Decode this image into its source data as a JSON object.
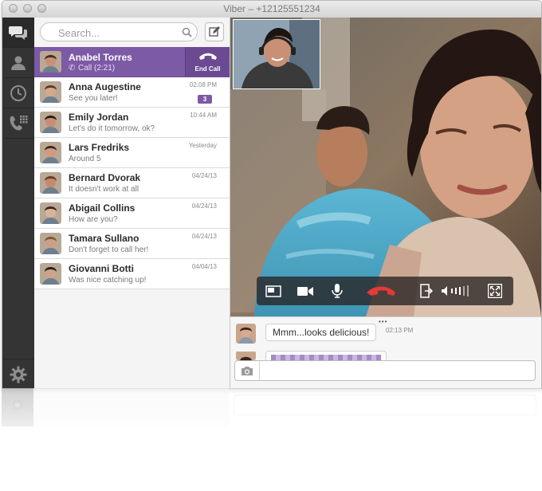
{
  "window": {
    "title": "Viber – +12125551234"
  },
  "search": {
    "placeholder": "Search..."
  },
  "contacts": [
    {
      "name": "Anabel Torres",
      "sub": "Call (2:21)",
      "time": "",
      "badge": "",
      "active": true,
      "skin": "#c99278",
      "hair": "#4a2a1c"
    },
    {
      "name": "Anna Augestine",
      "sub": "See you later!",
      "time": "02:08 PM",
      "badge": "3",
      "active": false,
      "skin": "#d6a88c",
      "hair": "#5a3a22"
    },
    {
      "name": "Emily Jordan",
      "sub": "Let's do it tomorrow, ok?",
      "time": "10:44 AM",
      "badge": "",
      "active": false,
      "skin": "#c98d73",
      "hair": "#2d1c14"
    },
    {
      "name": "Lars Fredriks",
      "sub": "Around 5",
      "time": "Yesterday",
      "badge": "",
      "active": false,
      "skin": "#d19c7e",
      "hair": "#3b2a20"
    },
    {
      "name": "Bernard Dvorak",
      "sub": "It doesn't work at all",
      "time": "04/24/13",
      "badge": "",
      "active": false,
      "skin": "#c38a6c",
      "hair": "#6e3b2a"
    },
    {
      "name": "Abigail Collins",
      "sub": "How are you?",
      "time": "04/24/13",
      "badge": "",
      "active": false,
      "skin": "#d8b39a",
      "hair": "#3a2a22"
    },
    {
      "name": "Tamara Sullano",
      "sub": "Don't forget to call her!",
      "time": "04/24/13",
      "badge": "",
      "active": false,
      "skin": "#caa089",
      "hair": "#7a5a3a"
    },
    {
      "name": "Giovanni Botti",
      "sub": "Was nice catching up!",
      "time": "04/04/13",
      "badge": "",
      "active": false,
      "skin": "#d0a286",
      "hair": "#222222"
    }
  ],
  "call": {
    "end_label": "End Call"
  },
  "chat": {
    "messages": [
      {
        "text": "Mmm...looks delicious!",
        "time": "02:13 PM"
      }
    ],
    "input_value": ""
  },
  "icons": {
    "rail": [
      "chat-bubbles-icon",
      "contacts-icon",
      "recents-clock-icon",
      "dialpad-icon",
      "gear-icon"
    ],
    "controls": [
      "pip-toggle-icon",
      "video-camera-icon",
      "microphone-icon",
      "hang-up-icon",
      "transfer-icon",
      "volume-icon",
      "fullscreen-icon"
    ]
  },
  "colors": {
    "accent": "#7d5aa6",
    "rail": "#343434",
    "hangup": "#e53a37"
  }
}
